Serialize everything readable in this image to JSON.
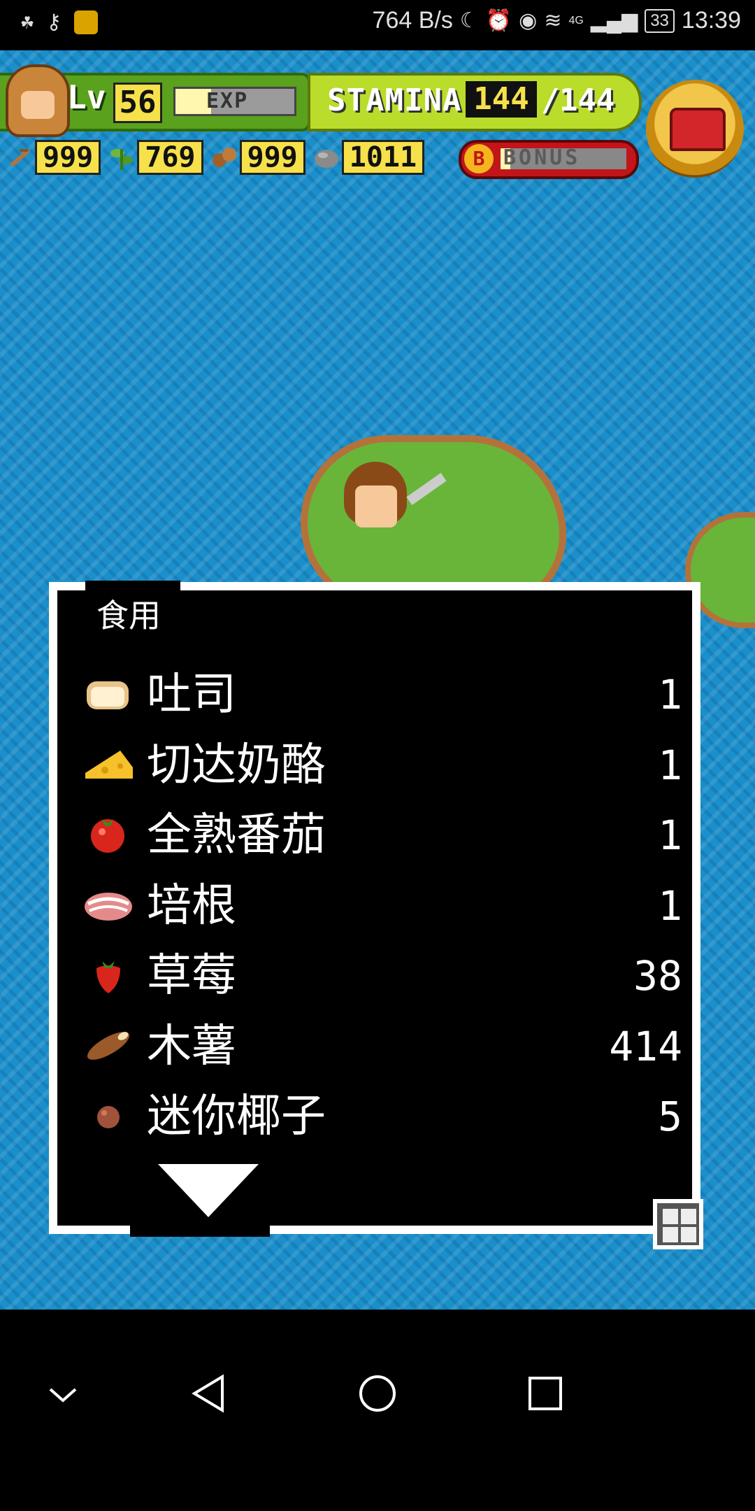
{
  "status_bar": {
    "net_speed": "764 B/s",
    "signal_label": "4G",
    "battery": "33",
    "time": "13:39"
  },
  "hud": {
    "level_label": "Lv",
    "level": "56",
    "exp_label": "EXP",
    "exp_fraction": 0.3,
    "stamina_label": "STAMINA",
    "stamina_current": "144",
    "stamina_separator": "/",
    "stamina_max": "144",
    "resources": [
      {
        "icon": "branch-icon",
        "value": "999"
      },
      {
        "icon": "herb-icon",
        "value": "769"
      },
      {
        "icon": "nuts-icon",
        "value": "999"
      },
      {
        "icon": "stone-icon",
        "value": "1011"
      }
    ],
    "bonus_badge": "B",
    "bonus_label": "BONUS"
  },
  "dialog": {
    "title": "食用",
    "items": [
      {
        "icon": "toast-icon",
        "name": "吐司",
        "qty": "1"
      },
      {
        "icon": "cheese-icon",
        "name": "切达奶酪",
        "qty": "1"
      },
      {
        "icon": "tomato-icon",
        "name": "全熟番茄",
        "qty": "1"
      },
      {
        "icon": "bacon-icon",
        "name": "培根",
        "qty": "1"
      },
      {
        "icon": "strawberry-icon",
        "name": "草莓",
        "qty": "38"
      },
      {
        "icon": "cassava-icon",
        "name": "木薯",
        "qty": "414"
      },
      {
        "icon": "mini-coconut-icon",
        "name": "迷你椰子",
        "qty": "5"
      }
    ]
  },
  "colors": {
    "ocean": "#1b8fca",
    "hud_green": "#5aa21d",
    "stamina_lime": "#b9dd2a",
    "value_yellow": "#f6e14b",
    "bonus_red": "#c1151a",
    "dialog_bg": "#000000",
    "dialog_border": "#ffffff"
  }
}
